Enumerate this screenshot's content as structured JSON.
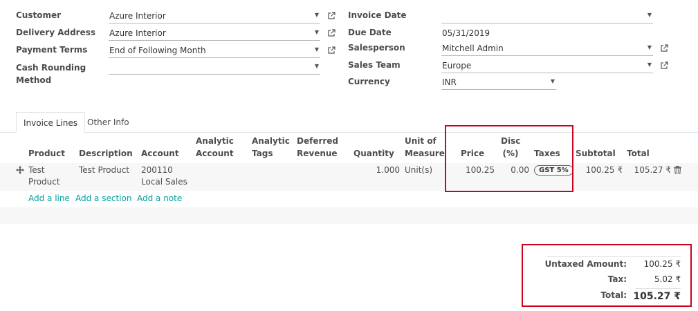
{
  "form": {
    "customer_label": "Customer",
    "customer_value": "Azure Interior",
    "delivery_label": "Delivery Address",
    "delivery_value": "Azure Interior",
    "terms_label": "Payment Terms",
    "terms_value": "End of Following Month",
    "rounding_label_1": "Cash Rounding",
    "rounding_label_2": "Method",
    "rounding_value": "",
    "invoice_date_label": "Invoice Date",
    "invoice_date_value": "",
    "due_date_label": "Due Date",
    "due_date_value": "05/31/2019",
    "salesperson_label": "Salesperson",
    "salesperson_value": "Mitchell Admin",
    "team_label": "Sales Team",
    "team_value": "Europe",
    "currency_label": "Currency",
    "currency_value": "INR"
  },
  "tabs": [
    "Invoice Lines",
    "Other Info"
  ],
  "table": {
    "headers": {
      "product": "Product",
      "description": "Description",
      "account": "Account",
      "analytic_account_1": "Analytic",
      "analytic_account_2": "Account",
      "analytic_tags_1": "Analytic",
      "analytic_tags_2": "Tags",
      "deferred_1": "Deferred",
      "deferred_2": "Revenue",
      "quantity": "Quantity",
      "uom_1": "Unit of",
      "uom_2": "Measure",
      "price": "Price",
      "disc_1": "Disc",
      "disc_2": "(%)",
      "taxes": "Taxes",
      "subtotal": "Subtotal",
      "total": "Total"
    },
    "row": {
      "product_1": "Test",
      "product_2": "Product",
      "description": "Test Product",
      "account_1": "200110",
      "account_2": "Local Sales",
      "quantity": "1.000",
      "uom": "Unit(s)",
      "price": "100.25",
      "disc": "0.00",
      "tax": "GST 5%",
      "subtotal": "100.25 ₹",
      "total": "105.27 ₹"
    },
    "actions": {
      "add_line": "Add a line",
      "add_section": "Add a section",
      "add_note": "Add a note"
    }
  },
  "totals": {
    "untaxed_label": "Untaxed Amount:",
    "untaxed_value": "100.25 ₹",
    "tax_label": "Tax:",
    "tax_value": "5.02 ₹",
    "total_label": "Total:",
    "total_value": "105.27 ₹"
  },
  "colors": {
    "link": "#00a09d",
    "highlight": "#d0021b"
  }
}
